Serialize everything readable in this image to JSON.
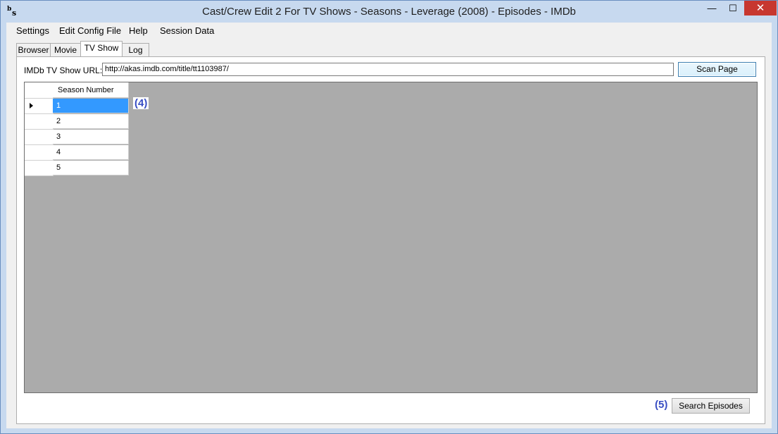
{
  "window": {
    "title": "Cast/Crew Edit 2 For TV Shows - Seasons - Leverage (2008) - Episodes - IMDb",
    "icon_letters": {
      "b": "b",
      "s": "s"
    },
    "controls": {
      "minimize": "—",
      "maximize": "☐",
      "close": "✕"
    }
  },
  "menu": [
    {
      "label": "Settings"
    },
    {
      "label": "Edit Config File"
    },
    {
      "label": "Help"
    },
    {
      "label": "Session Data"
    }
  ],
  "tabs": [
    {
      "label": "Browser"
    },
    {
      "label": "Movie"
    },
    {
      "label": "TV Show"
    },
    {
      "label": "Log"
    }
  ],
  "url_label": "IMDb TV Show URL:",
  "url_value": "http://akas.imdb.com/title/tt1103987/",
  "scan_button": "Scan Page",
  "grid": {
    "column_header": "Season Number",
    "rows": [
      "1",
      "2",
      "3",
      "4",
      "5"
    ],
    "selected_row": "1"
  },
  "markers": {
    "grid": "(4)",
    "search": "(5)"
  },
  "search_button": "Search Episodes",
  "colors": {
    "selection": "#3399ff",
    "marker": "#3a4fc4",
    "close": "#c7372f"
  }
}
